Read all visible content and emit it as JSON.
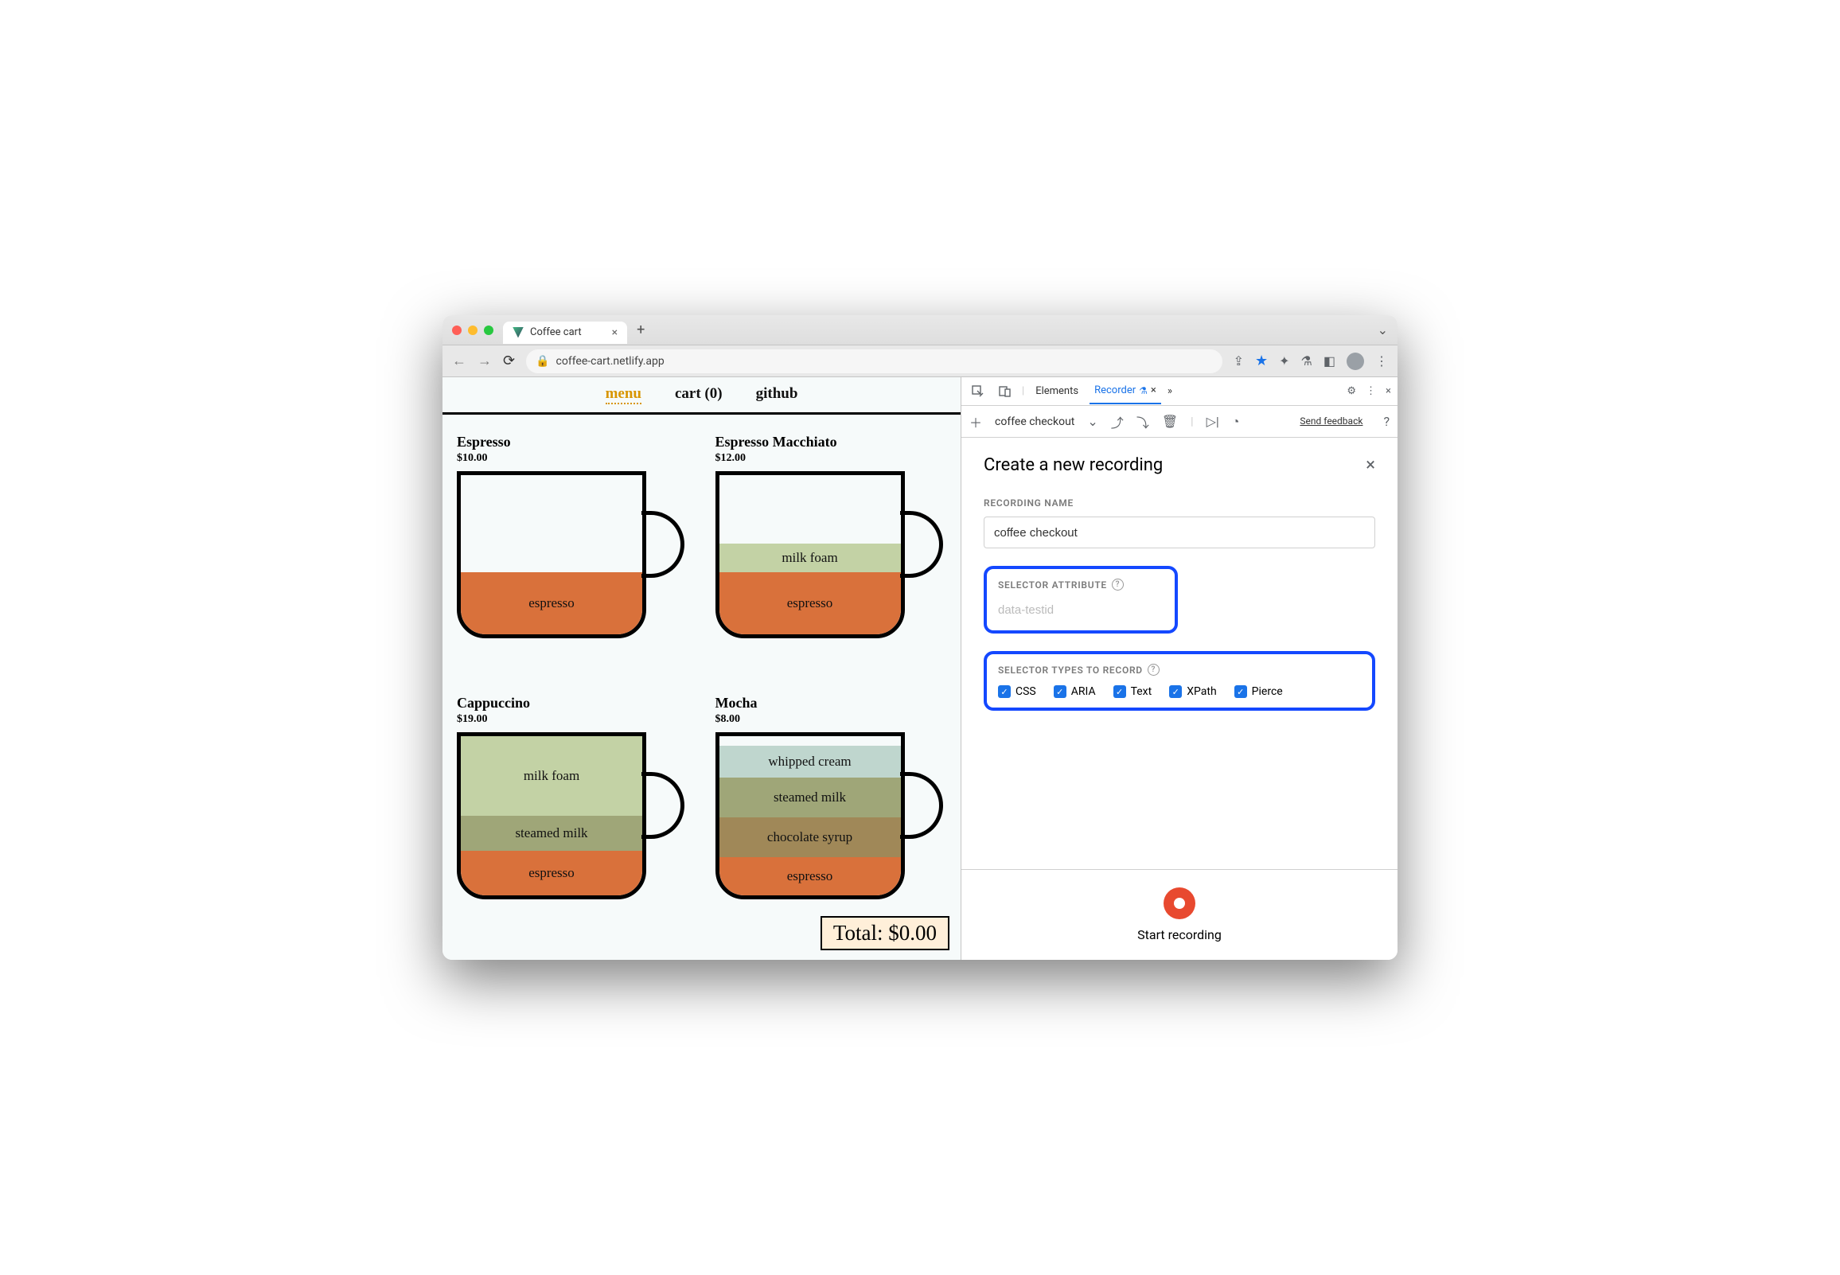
{
  "browser": {
    "tab_title": "Coffee cart",
    "url": "coffee-cart.netlify.app"
  },
  "page": {
    "nav": {
      "menu": "menu",
      "cart": "cart (0)",
      "github": "github"
    },
    "total_label": "Total: $0.00",
    "items": [
      {
        "name": "Espresso",
        "price": "$10.00",
        "layers": [
          "espresso"
        ]
      },
      {
        "name": "Espresso Macchiato",
        "price": "$12.00",
        "layers": [
          "milk foam",
          "espresso"
        ]
      },
      {
        "name": "Cappuccino",
        "price": "$19.00",
        "layers": [
          "milk foam",
          "steamed milk",
          "espresso"
        ]
      },
      {
        "name": "Mocha",
        "price": "$8.00",
        "layers": [
          "whipped cream",
          "steamed milk",
          "chocolate syrup",
          "espresso"
        ]
      }
    ]
  },
  "devtools": {
    "tabs": {
      "elements": "Elements",
      "recorder": "Recorder"
    },
    "toolbar": {
      "flow_name": "coffee checkout",
      "feedback": "Send feedback"
    },
    "panel": {
      "title": "Create a new recording",
      "recording_name_label": "RECORDING NAME",
      "recording_name_value": "coffee checkout",
      "selector_attr_label": "SELECTOR ATTRIBUTE",
      "selector_attr_placeholder": "data-testid",
      "selector_types_label": "SELECTOR TYPES TO RECORD",
      "types": {
        "css": "CSS",
        "aria": "ARIA",
        "text": "Text",
        "xpath": "XPath",
        "pierce": "Pierce"
      },
      "start_label": "Start recording"
    }
  }
}
